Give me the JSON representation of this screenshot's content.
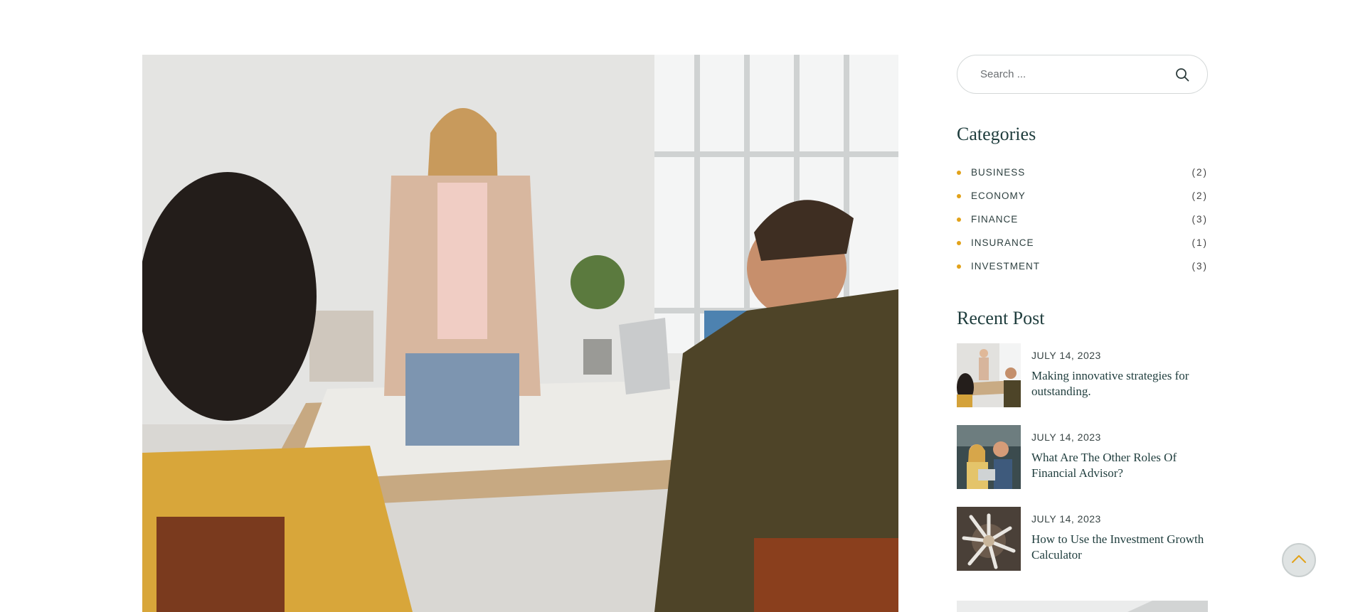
{
  "hero": {
    "image_alt": "Business team meeting around a table"
  },
  "search": {
    "placeholder": "Search ..."
  },
  "categories": {
    "title": "Categories",
    "items": [
      {
        "name": "BUSINESS",
        "count": "(2)"
      },
      {
        "name": "ECONOMY",
        "count": "(2)"
      },
      {
        "name": "FINANCE",
        "count": "(3)"
      },
      {
        "name": "INSURANCE",
        "count": "(1)"
      },
      {
        "name": "INVESTMENT",
        "count": "(3)"
      }
    ]
  },
  "recent": {
    "title": "Recent Post",
    "posts": [
      {
        "date": "JULY 14, 2023",
        "title": "Making innovative strategies for outstanding."
      },
      {
        "date": "JULY 14, 2023",
        "title": "What Are The Other Roles Of Financial Advisor?"
      },
      {
        "date": "JULY 14, 2023",
        "title": "How to Use the Investment Growth Calculator"
      }
    ]
  },
  "icons": {
    "search": "search-icon",
    "back_to_top": "chevron-up-icon",
    "bullet": "dot-icon"
  },
  "colors": {
    "accent": "#e2a21a",
    "heading": "#1f3d3d",
    "border": "#d4d8d8"
  }
}
